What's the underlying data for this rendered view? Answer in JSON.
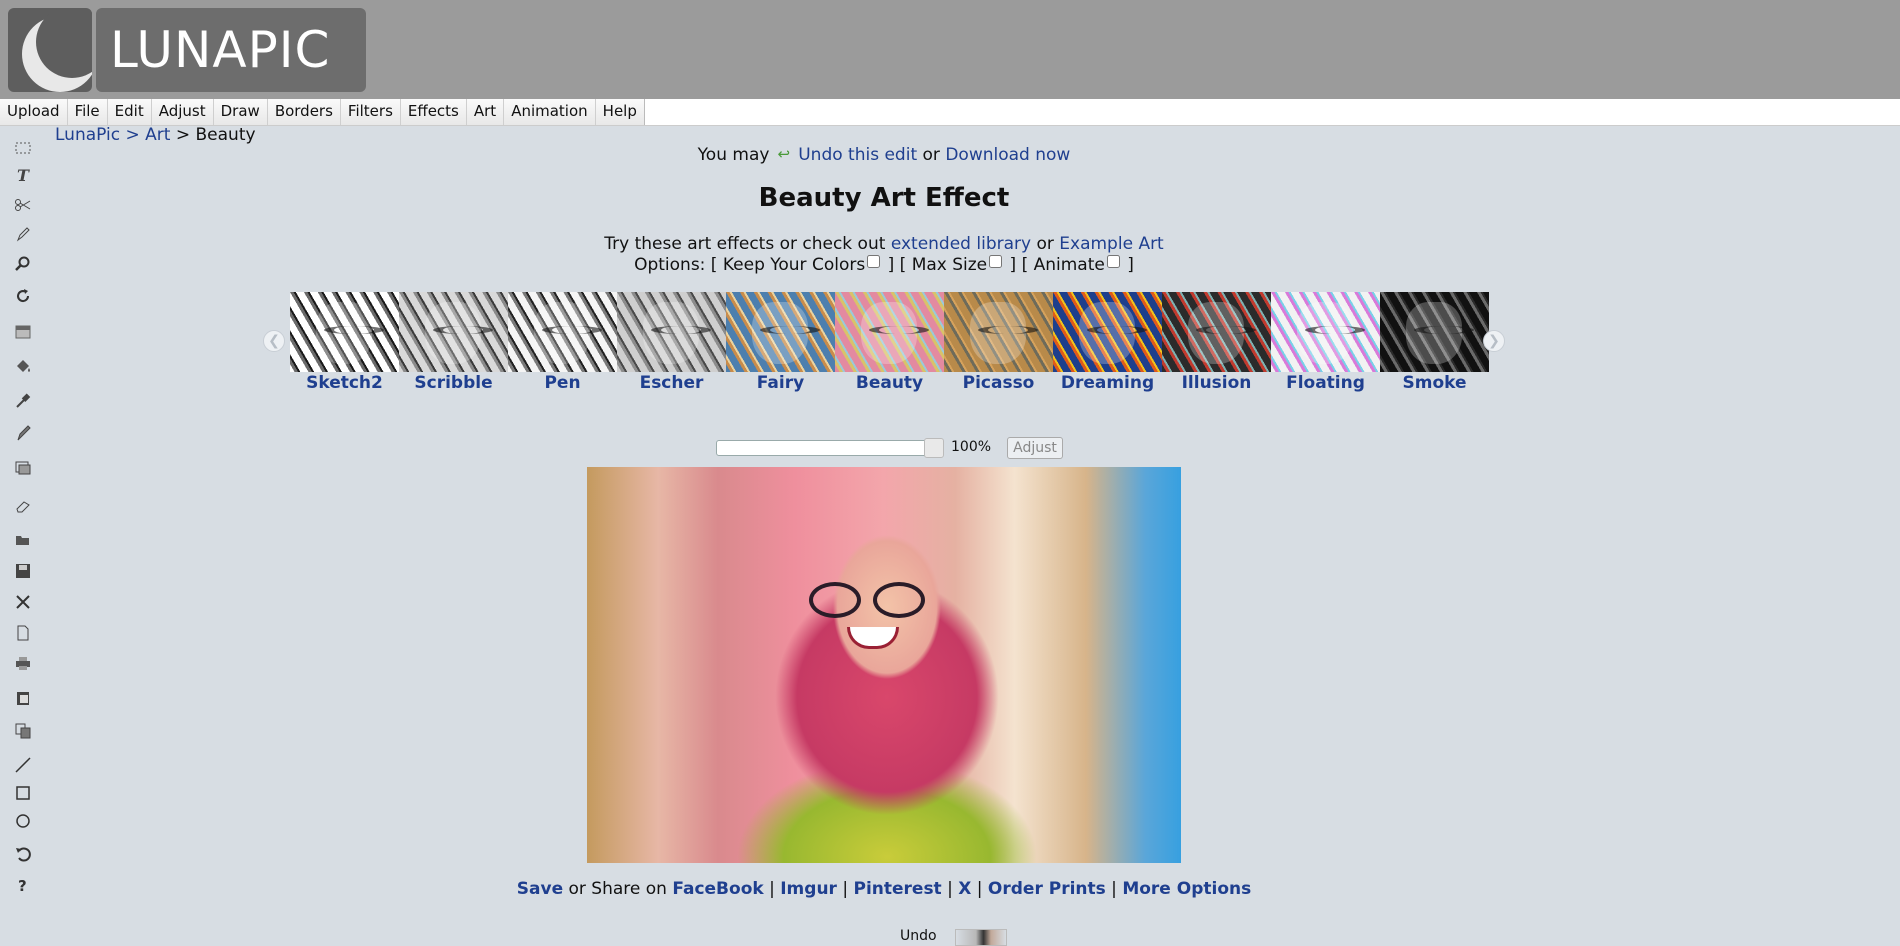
{
  "header": {
    "logo_text": "LUNAPIC"
  },
  "menu": [
    "Upload",
    "File",
    "Edit",
    "Adjust",
    "Draw",
    "Borders",
    "Filters",
    "Effects",
    "Art",
    "Animation",
    "Help"
  ],
  "tools": [
    "select-icon",
    "text-icon",
    "scissors-icon",
    "pencil-icon",
    "zoom-icon",
    "rotate-icon",
    "gradient-icon",
    "paint-bucket-icon",
    "eyedropper-icon",
    "brush-icon",
    "crop-icon",
    "eraser-icon",
    "open-folder-icon",
    "save-icon",
    "close-icon",
    "new-file-icon",
    "print-icon",
    "paste-icon",
    "copy-icon",
    "line-icon",
    "rectangle-icon",
    "circle-icon",
    "undo-icon",
    "help-icon"
  ],
  "breadcrumb": {
    "root": "LunaPic",
    "sep": ">",
    "section": "Art",
    "current": "Beauty"
  },
  "notice": {
    "prefix": "You may",
    "undo": "Undo this edit",
    "or": "or",
    "download": "Download now"
  },
  "title": "Beauty Art Effect",
  "intro": {
    "text": "Try these art effects or check out",
    "library": "extended library",
    "or": "or",
    "example": "Example Art"
  },
  "options": {
    "label": "Options: [",
    "keep_colors": "Keep Your Colors",
    "max_size": "Max Size",
    "animate": "Animate",
    "close": "]",
    "between": "] ["
  },
  "effects": [
    {
      "label": "Sketch2",
      "colors": [
        "#ffffff",
        "#6a6a6a",
        "#1a1a1a"
      ]
    },
    {
      "label": "Scribble",
      "colors": [
        "#d9d9d9",
        "#8a8a8a",
        "#3a3a3a"
      ]
    },
    {
      "label": "Pen",
      "colors": [
        "#f5f5f5",
        "#7a7a7a",
        "#222222"
      ]
    },
    {
      "label": "Escher",
      "colors": [
        "#cfcfcf",
        "#8c8c8c",
        "#4a4a4a"
      ]
    },
    {
      "label": "Fairy",
      "colors": [
        "#4d7fae",
        "#c98c4b",
        "#e9d3a0"
      ]
    },
    {
      "label": "Beauty",
      "colors": [
        "#e38aa0",
        "#d9c26a",
        "#9ac9d9"
      ]
    },
    {
      "label": "Picasso",
      "colors": [
        "#b88a4a",
        "#6e6b5a",
        "#d6a25c"
      ]
    },
    {
      "label": "Dreaming",
      "colors": [
        "#1e3f8c",
        "#e05a1a",
        "#f0c21c"
      ]
    },
    {
      "label": "Illusion",
      "colors": [
        "#2b2b2b",
        "#c23a2e",
        "#7fb0b0"
      ]
    },
    {
      "label": "Floating",
      "colors": [
        "#f2f2f2",
        "#d97ad9",
        "#7ad0e8"
      ]
    },
    {
      "label": "Smoke",
      "colors": [
        "#111111",
        "#6a6a6a",
        "#2a2a2a"
      ]
    }
  ],
  "zoom": {
    "value_label": "100%",
    "level": 1.0,
    "button": "Adjust"
  },
  "share": {
    "save": "Save",
    "middle": "or Share on",
    "facebook": "FaceBook",
    "imgur": "Imgur",
    "pinterest": "Pinterest",
    "x": "X",
    "prints": "Order Prints",
    "more": "More Options",
    "sep": "|"
  },
  "undo_label": "Undo"
}
